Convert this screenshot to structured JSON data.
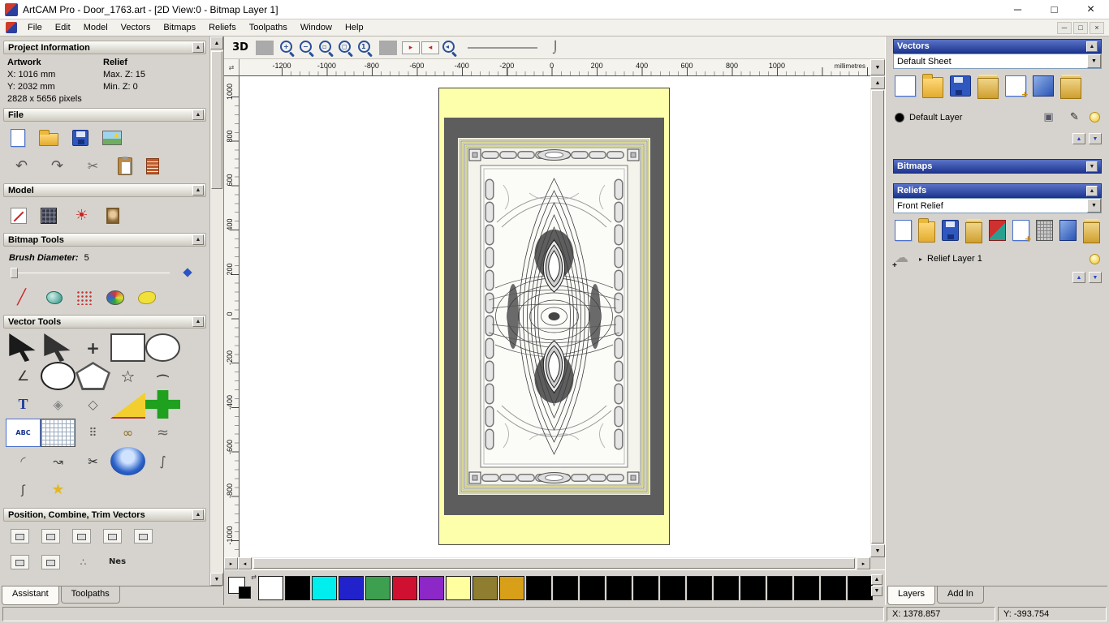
{
  "glyphs": {
    "up": "▲",
    "down": "▼",
    "left": "◂",
    "right": "▸",
    "swap": "⇄",
    "minimize": "─",
    "maximize": "□",
    "close": "×"
  },
  "window": {
    "title": "ArtCAM Pro - Door_1763.art - [2D View:0 - Bitmap Layer 1]"
  },
  "menu": {
    "items": [
      "File",
      "Edit",
      "Model",
      "Vectors",
      "Bitmaps",
      "Reliefs",
      "Toolpaths",
      "Window",
      "Help"
    ]
  },
  "assistant": {
    "tabs": {
      "assistant": "Assistant",
      "toolpaths": "Toolpaths"
    },
    "project": {
      "title": "Project Information",
      "artwork_label": "Artwork",
      "relief_label": "Relief",
      "x": "X: 1016 mm",
      "y": "Y: 2032 mm",
      "max_z": "Max. Z: 15",
      "min_z": "Min. Z: 0",
      "pixels": "2828 x 5656 pixels"
    },
    "file": {
      "title": "File",
      "row1": [
        {
          "n": "new-model-icon",
          "k": "page"
        },
        {
          "n": "open-model-icon",
          "k": "folder"
        },
        {
          "n": "save-model-icon",
          "k": "disk"
        },
        {
          "n": "import-model-icon",
          "k": "picture"
        }
      ],
      "row2": [
        {
          "n": "undo-icon",
          "g": "↶",
          "c": "#555",
          "fs": 18
        },
        {
          "n": "redo-icon",
          "g": "↷",
          "c": "#555",
          "fs": 18
        },
        {
          "n": "cut-icon",
          "g": "✂",
          "c": "#666",
          "fs": 16
        },
        {
          "n": "paste-icon",
          "k": "clipboard"
        },
        {
          "n": "notes-icon",
          "k": "notes"
        }
      ]
    },
    "model": {
      "title": "Model",
      "icons": [
        {
          "n": "set-model-size-icon",
          "k": "modelsize"
        },
        {
          "n": "adjust-model-icon",
          "k": "darkgrid"
        },
        {
          "n": "lighting-icon",
          "g": "☀",
          "c": "#cc2222",
          "fs": 18
        },
        {
          "n": "load-texture-icon",
          "k": "portrait"
        }
      ]
    },
    "bitmap": {
      "title": "Bitmap Tools",
      "brush_label": "Brush Diameter:",
      "brush_value": "5",
      "icons": [
        {
          "n": "paint-brush-icon",
          "g": "╱",
          "c": "#cc2222",
          "fs": 18,
          "b": true
        },
        {
          "n": "paint-selective-icon",
          "k": "teal"
        },
        {
          "n": "spray-icon",
          "k": "spray"
        },
        {
          "n": "palette-icon",
          "k": "palette"
        },
        {
          "n": "flood-fill-icon",
          "k": "blob"
        }
      ]
    },
    "vector": {
      "title": "Vector Tools",
      "tools": [
        {
          "n": "select-vectors-icon",
          "k": "cursor"
        },
        {
          "n": "node-editing-icon",
          "k": "cursor2"
        },
        {
          "n": "transform-vectors-icon",
          "g": "+",
          "c": "#333",
          "fs": 20,
          "b": true
        },
        {
          "n": "create-rectangle-icon",
          "k": "rect"
        },
        {
          "n": "create-ellipse-icon",
          "k": "circle"
        },
        {
          "n": "create-polyline-icon",
          "g": "∠",
          "c": "#333",
          "fs": 17
        },
        {
          "n": "create-circle-icon",
          "k": "circle2"
        },
        {
          "n": "create-polygon-icon",
          "k": "pent"
        },
        {
          "n": "create-star-icon",
          "g": "☆",
          "c": "#333",
          "fs": 20
        },
        {
          "n": "create-arc-icon",
          "k": "rot90",
          "g": "(",
          "c": "#333",
          "fs": 17
        },
        {
          "n": "create-text-icon",
          "k": "serifT",
          "g": "T",
          "c": "#1a3a9f",
          "fs": 18
        },
        {
          "n": "measure-icon",
          "g": "◈",
          "c": "#888",
          "fs": 16
        },
        {
          "n": "offset-vectors-icon",
          "g": "◇",
          "c": "#666",
          "fs": 16
        },
        {
          "n": "fillet-icon",
          "k": "slice"
        },
        {
          "n": "block-copy-icon",
          "k": "plusgreen"
        },
        {
          "n": "wrap-text-icon",
          "k": "abc",
          "g": "ABC"
        },
        {
          "n": "paste-along-curve-icon",
          "k": "grid"
        },
        {
          "n": "nest-vectors-icon",
          "g": "⠿",
          "c": "#555",
          "fs": 14
        },
        {
          "n": "bead-chain-icon",
          "g": "∞",
          "c": "#886a22",
          "fs": 16
        },
        {
          "n": "wave-icon",
          "g": "≈",
          "c": "#666",
          "fs": 18
        },
        {
          "n": "fit-arcs-icon",
          "g": "◜",
          "c": "#666",
          "fs": 16
        },
        {
          "n": "join-vectors-icon",
          "g": "↝",
          "c": "#444",
          "fs": 15
        },
        {
          "n": "trim-vectors-icon",
          "g": "✂",
          "c": "#222",
          "fs": 15
        },
        {
          "n": "extrude-icon",
          "k": "donut"
        },
        {
          "n": "spline-icon",
          "g": "∫",
          "c": "#555",
          "fs": 16
        },
        {
          "n": "section-icon",
          "g": "ʃ",
          "c": "#444",
          "fs": 15
        },
        {
          "n": "star-wrap-icon",
          "g": "★",
          "c": "#e3b71e",
          "fs": 18
        }
      ]
    },
    "position": {
      "title": "Position, Combine, Trim Vectors",
      "row1": [
        {
          "n": "center-in-page-icon",
          "k": "align"
        },
        {
          "n": "align-centers-icon",
          "k": "align"
        },
        {
          "n": "align-top-icon",
          "k": "align"
        },
        {
          "n": "align-bottom-icon",
          "k": "align"
        },
        {
          "n": "align-left-icon",
          "k": "align"
        }
      ],
      "row2": [
        {
          "n": "align-right-icon",
          "k": "align"
        },
        {
          "n": "mirror-icon",
          "k": "align"
        },
        {
          "n": "group-icon",
          "g": "∴",
          "c": "#555",
          "fs": 12
        },
        {
          "n": "nesting-icon",
          "g": "Nes",
          "c": "#222",
          "fs": 10,
          "b": true
        }
      ]
    }
  },
  "canvas": {
    "toolbar": [
      {
        "n": "view-3d-button",
        "k": "t3d",
        "g": "3D"
      },
      {
        "n": "toolbar-separator",
        "k": "sep",
        "i": false
      },
      {
        "n": "zoom-in-icon",
        "k": "zoom",
        "g": "+"
      },
      {
        "n": "zoom-out-icon",
        "k": "zoom",
        "g": "−"
      },
      {
        "n": "zoom-window-icon",
        "k": "zoom",
        "g": "▫"
      },
      {
        "n": "zoom-fit-icon",
        "k": "zoom",
        "g": "◻"
      },
      {
        "n": "zoom-scale-icon",
        "k": "zoom",
        "g": "1"
      },
      {
        "n": "toolbar-separator",
        "k": "sep",
        "i": false
      },
      {
        "n": "snap-next-icon",
        "k": "pan",
        "g": "▸"
      },
      {
        "n": "snap-prev-icon",
        "k": "pan",
        "g": "◂"
      },
      {
        "n": "zoom-previous-icon",
        "k": "zoom",
        "g": "◂"
      },
      {
        "n": "line-width-sample",
        "k": "linesample",
        "i": false
      },
      {
        "n": "curve-sample-icon",
        "g": "⌡",
        "c": "#555",
        "fs": 14,
        "i": false
      }
    ],
    "h_ticks": [
      "-1200",
      "-1000",
      "-800",
      "-600",
      "-400",
      "-200",
      "0",
      "200",
      "400",
      "600",
      "800",
      "1000"
    ],
    "v_ticks": [
      "1000",
      "800",
      "600",
      "400",
      "200",
      "0",
      "-200",
      "-400",
      "-600",
      "-800",
      "-1000"
    ],
    "unit": "millimetres"
  },
  "palette": {
    "swatches": [
      {
        "n": "color-swatch-white",
        "bg": "#ffffff"
      },
      {
        "n": "color-swatch-black",
        "bg": "#000000"
      },
      {
        "n": "color-swatch-cyan",
        "bg": "#00eeee"
      },
      {
        "n": "color-swatch-blue",
        "bg": "#2222cc"
      },
      {
        "n": "color-swatch-green",
        "bg": "#3ca050"
      },
      {
        "n": "color-swatch-red",
        "bg": "#d01030"
      },
      {
        "n": "color-swatch-purple",
        "bg": "#8c28c8"
      },
      {
        "n": "color-swatch-pale-yellow",
        "bg": "#ffffa0"
      },
      {
        "n": "color-swatch-olive",
        "bg": "#8f7d30"
      },
      {
        "n": "color-swatch-gold",
        "bg": "#d8a018"
      },
      {
        "n": "color-swatch-black",
        "bg": "#000000"
      },
      {
        "n": "color-swatch-black",
        "bg": "#000000"
      },
      {
        "n": "color-swatch-black",
        "bg": "#000000"
      },
      {
        "n": "color-swatch-black",
        "bg": "#000000"
      },
      {
        "n": "color-swatch-black",
        "bg": "#000000"
      },
      {
        "n": "color-swatch-black",
        "bg": "#000000"
      },
      {
        "n": "color-swatch-black",
        "bg": "#000000"
      },
      {
        "n": "color-swatch-black",
        "bg": "#000000"
      },
      {
        "n": "color-swatch-black",
        "bg": "#000000"
      },
      {
        "n": "color-swatch-black",
        "bg": "#000000"
      },
      {
        "n": "color-swatch-black",
        "bg": "#000000"
      },
      {
        "n": "color-swatch-black",
        "bg": "#000000"
      },
      {
        "n": "color-swatch-black",
        "bg": "#000000"
      }
    ]
  },
  "panels": {
    "vectors": {
      "title": "Vectors",
      "sheet": "Default Sheet",
      "icons": [
        {
          "n": "new-vector-sheet-icon",
          "k": "page"
        },
        {
          "n": "open-vectors-icon",
          "k": "folder"
        },
        {
          "n": "save-vectors-icon",
          "k": "disk"
        },
        {
          "n": "sheet-stack-icon",
          "k": "stack"
        },
        {
          "n": "new-vector-layer-icon",
          "k": "pagep"
        },
        {
          "n": "merge-layers-icon",
          "k": "cubeb"
        },
        {
          "n": "toggle-all-layers-icon",
          "k": "stack"
        }
      ],
      "layer": {
        "name": "Default Layer",
        "right_icons": [
          {
            "n": "layer-snap-icon",
            "g": "▣",
            "c": "#556",
            "fs": 13
          },
          {
            "n": "layer-edit-icon",
            "g": "✎",
            "c": "#222",
            "fs": 13
          },
          {
            "n": "layer-visibility-icon",
            "k": "bulb"
          }
        ]
      }
    },
    "bitmaps": {
      "title": "Bitmaps"
    },
    "reliefs": {
      "title": "Reliefs",
      "relief": "Front Relief",
      "icons": [
        {
          "n": "new-relief-icon",
          "k": "page"
        },
        {
          "n": "open-relief-icon",
          "k": "folder"
        },
        {
          "n": "save-relief-icon",
          "k": "disk"
        },
        {
          "n": "relief-stack-icon",
          "k": "stack"
        },
        {
          "n": "reset-relief-icon",
          "k": "resetred"
        },
        {
          "n": "new-relief-layer-icon",
          "k": "pagep"
        },
        {
          "n": "relief-grid-icon",
          "k": "chip"
        },
        {
          "n": "merge-relief-icon",
          "k": "cubeb"
        },
        {
          "n": "relief-options-icon",
          "k": "stack"
        }
      ],
      "layer": {
        "name": "Relief Layer 1"
      }
    },
    "tabs": {
      "layers": "Layers",
      "addin": "Add In"
    }
  },
  "status": {
    "x": "X: 1378.857",
    "y": "Y: -393.754"
  }
}
